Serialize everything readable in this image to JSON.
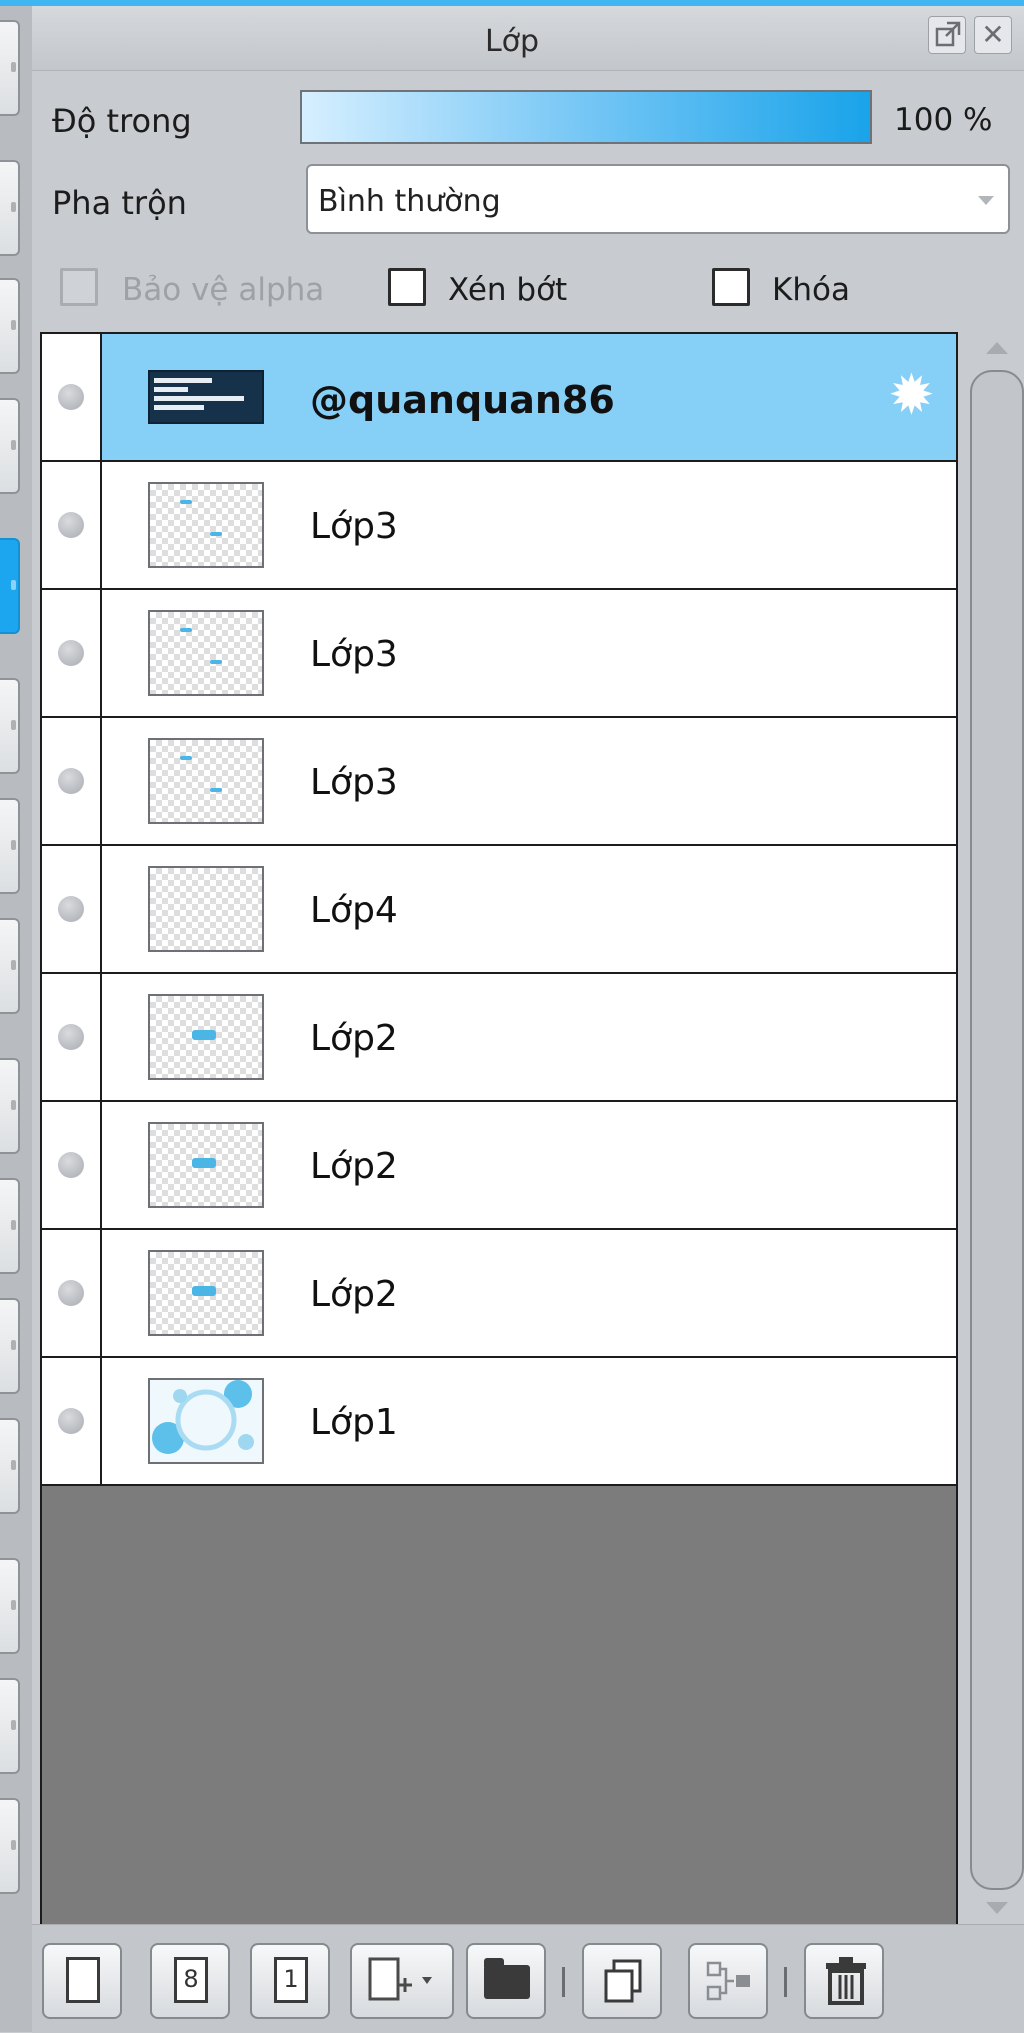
{
  "panel": {
    "title": "Lớp",
    "popout_icon": "popout-icon",
    "close_icon": "close-icon"
  },
  "opacity": {
    "label": "Độ trong",
    "value_text": "100 %",
    "value": 1.0
  },
  "blend": {
    "label": "Pha trộn",
    "value": "Bình thường"
  },
  "options": {
    "alpha_protect": "Bảo vệ alpha",
    "clipping": "Xén bớt",
    "lock": "Khóa"
  },
  "layers": [
    {
      "name": "@quanquan86",
      "selected": true
    },
    {
      "name": "Lớp3"
    },
    {
      "name": "Lớp3"
    },
    {
      "name": "Lớp3"
    },
    {
      "name": "Lớp4"
    },
    {
      "name": "Lớp2"
    },
    {
      "name": "Lớp2"
    },
    {
      "name": "Lớp2"
    },
    {
      "name": "Lớp1"
    }
  ],
  "toolbar": {
    "page8_label": "8",
    "page1_label": "1",
    "icons": [
      "new-layer-icon",
      "new-8bit-layer-icon",
      "new-1bit-layer-icon",
      "add-layer-menu-icon",
      "new-folder-icon",
      "duplicate-layer-icon",
      "merge-layer-icon",
      "delete-layer-icon"
    ]
  },
  "colors": {
    "accent": "#1ba6ef",
    "selected_row": "#86cff6",
    "list_background": "#7c7c7c"
  }
}
